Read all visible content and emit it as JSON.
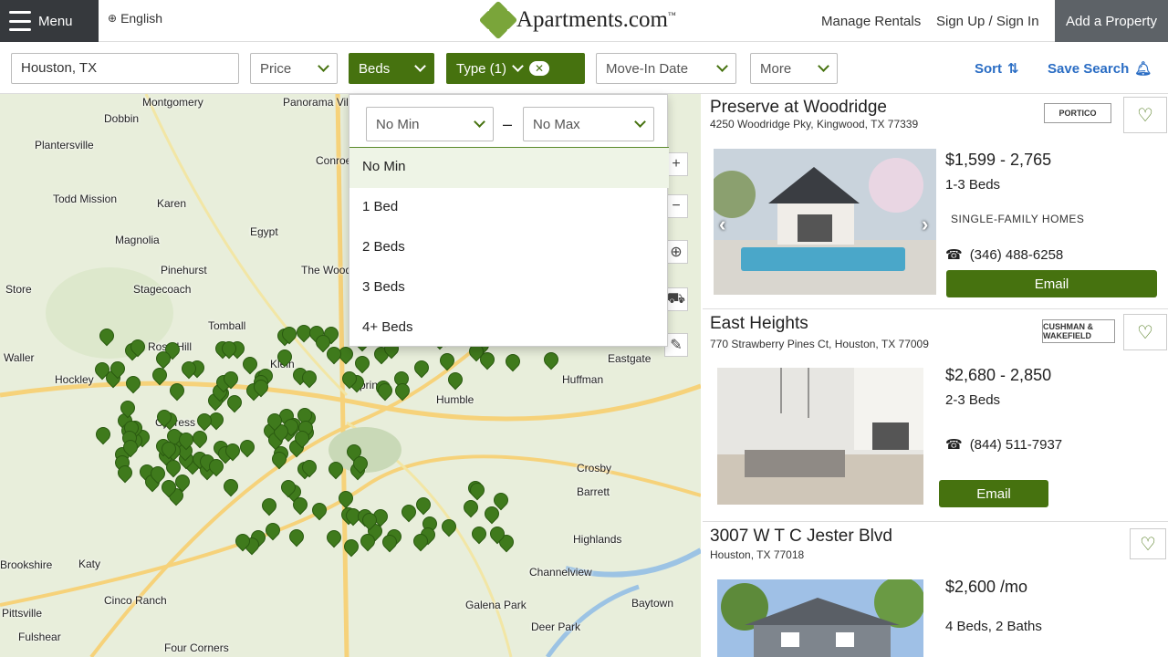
{
  "header": {
    "menu_label": "Menu",
    "language": "English",
    "logo_text": "Apartments.com",
    "logo_tm": "™",
    "manage_rentals": "Manage Rentals",
    "sign_in": "Sign Up / Sign In",
    "add_property": "Add a Property"
  },
  "filters": {
    "location": "Houston, TX",
    "price": "Price",
    "beds": "Beds",
    "type": "Type (1)",
    "move_in": "Move-In Date",
    "more": "More",
    "sort": "Sort",
    "save_search": "Save Search"
  },
  "beds_dropdown": {
    "min": "No Min",
    "max": "No Max",
    "options": [
      "No Min",
      "1 Bed",
      "2 Beds",
      "3 Beds",
      "4+ Beds"
    ]
  },
  "map": {
    "cities": [
      "Montgomery",
      "Panorama Village",
      "Dobbin",
      "Plantersville",
      "Conroe",
      "Todd Mission",
      "Karen",
      "Egypt",
      "Magnolia",
      "Pinehurst",
      "Stagecoach",
      "The Woodlands",
      "Store",
      "Tomball",
      "Rose Hill",
      "Waller",
      "Hockley",
      "Klein",
      "Cypress",
      "Spring",
      "Humble",
      "Huffman",
      "Eastgate",
      "Crosby",
      "Barrett",
      "Highlands",
      "Channelview",
      "Baytown",
      "Deer Park",
      "Galena Park",
      "Katy",
      "Cinco Ranch",
      "Fulshear",
      "Four Corners",
      "Pittsville",
      "Brookshire"
    ],
    "controls": [
      "+",
      "−"
    ]
  },
  "listings": [
    {
      "title": "Preserve at Woodridge",
      "address": "4250 Woodridge Pky, Kingwood, TX 77339",
      "price": "$1,599 - 2,765",
      "beds": "1-3 Beds",
      "tag": "SINGLE-FAMILY HOMES",
      "phone": "(346) 488-6258",
      "email": "Email",
      "brand": "PORTICO"
    },
    {
      "title": "East Heights",
      "address": "770 Strawberry Pines Ct, Houston, TX 77009",
      "price": "$2,680 - 2,850",
      "beds": "2-3 Beds",
      "phone": "(844) 511-7937",
      "email": "Email",
      "brand": "CUSHMAN & WAKEFIELD"
    },
    {
      "title": "3007 W T C Jester Blvd",
      "address": "Houston, TX 77018",
      "price": "$2,600 /mo",
      "beds": "4 Beds, 2 Baths"
    }
  ],
  "colors": {
    "brand_green": "#46720f",
    "link_blue": "#2a6dc4",
    "header_dark": "#36393d"
  }
}
